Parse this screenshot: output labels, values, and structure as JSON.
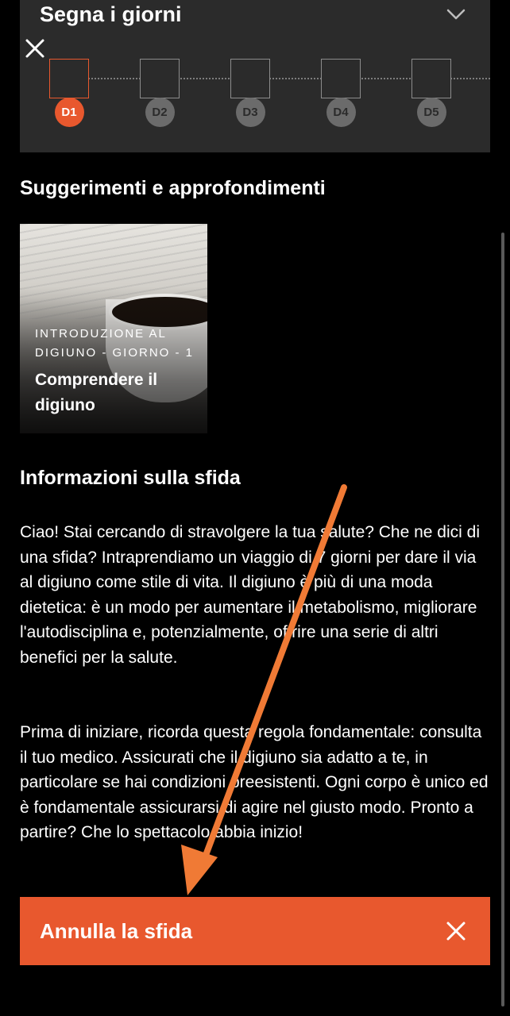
{
  "tracker": {
    "title": "Segna i giorni",
    "days": [
      "D1",
      "D2",
      "D3",
      "D4",
      "D5"
    ],
    "active_day": "D1"
  },
  "tips": {
    "heading": "Suggerimenti e approfondimenti",
    "card": {
      "kicker": "INTRODUZIONE AL DIGIUNO - GIORNO - 1",
      "title": "Comprendere il digiuno"
    }
  },
  "info": {
    "heading": "Informazioni sulla sfida",
    "paragraph1": "Ciao! Stai cercando di stravolgere la tua salute? Che ne dici di una sfida? Intraprendiamo un viaggio di 7 giorni per dare il via al digiuno come stile di vita. Il digiuno è più di una moda dietetica: è un modo per aumentare il metabolismo, migliorare l'autodisciplina e, potenzialmente, offrire una serie di altri benefici per la salute.",
    "paragraph2": "Prima di iniziare, ricorda questa regola fondamentale: consulta il tuo medico. Assicurati che il digiuno sia adatto a te, in particolare se hai condizioni preesistenti. Ogni corpo è unico ed è fondamentale assicurarsi di agire nel giusto modo. Pronto a partire? Che lo spettacolo abbia inizio!"
  },
  "cancel_button": {
    "label": "Annulla la sfida"
  },
  "colors": {
    "accent": "#e8582e",
    "panel": "#2b2b2b",
    "background": "#000000"
  }
}
